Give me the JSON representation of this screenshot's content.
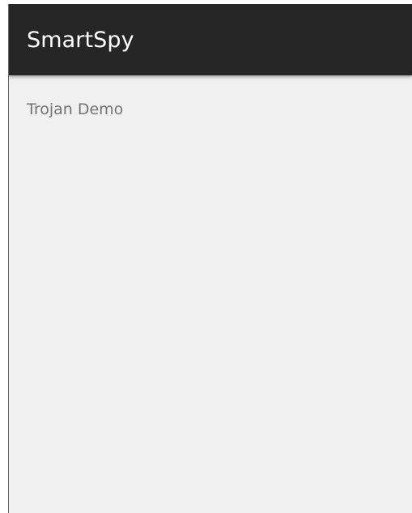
{
  "app_bar": {
    "title": "SmartSpy"
  },
  "main": {
    "text": "Trojan Demo"
  }
}
